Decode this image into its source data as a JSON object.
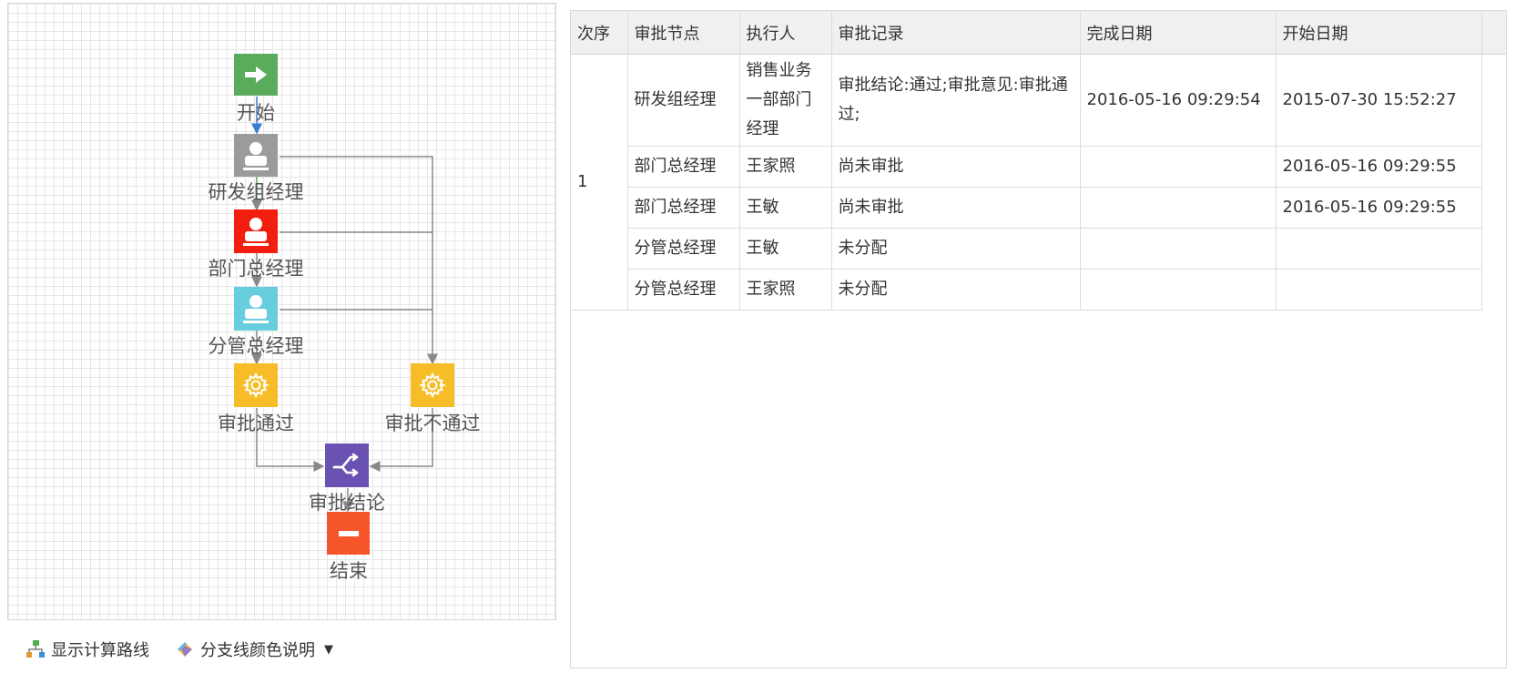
{
  "flow": {
    "nodes": {
      "start": "开始",
      "rd_manager": "研发组经理",
      "dept_manager": "部门总经理",
      "branch_manager": "分管总经理",
      "approve_pass": "审批通过",
      "approve_fail": "审批不通过",
      "conclusion": "审批结论",
      "end": "结束"
    },
    "colors": {
      "start": "#5aac5c",
      "rd_manager": "#9b9b9b",
      "dept_manager": "#f21f10",
      "branch_manager": "#67cedf",
      "approve_pass": "#f6bd29",
      "approve_fail": "#f6bd29",
      "conclusion": "#6a52b3",
      "end": "#f6562a",
      "line": "#888888",
      "line_highlight": "#3a7bd5"
    }
  },
  "toolbar": {
    "show_route": "显示计算路线",
    "branch_color": "分支线颜色说明"
  },
  "table": {
    "headers": [
      "次序",
      "审批节点",
      "执行人",
      "审批记录",
      "完成日期",
      "开始日期"
    ],
    "group_order": "1",
    "rows": [
      [
        "研发组经理",
        "销售业务一部部门经理",
        "审批结论:通过;审批意见:审批通过;",
        "2016-05-16 09:29:54",
        "2015-07-30 15:52:27"
      ],
      [
        "部门总经理",
        "王家照",
        "尚未审批",
        "",
        "2016-05-16 09:29:55"
      ],
      [
        "部门总经理",
        "王敏",
        "尚未审批",
        "",
        "2016-05-16 09:29:55"
      ],
      [
        "分管总经理",
        "王敏",
        "未分配",
        "",
        ""
      ],
      [
        "分管总经理",
        "王家照",
        "未分配",
        "",
        ""
      ]
    ]
  }
}
